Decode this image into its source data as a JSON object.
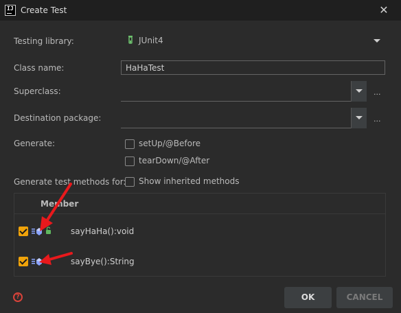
{
  "window": {
    "title": "Create Test",
    "app_icon_text": "IJ"
  },
  "form": {
    "testing_library_label": "Testing library:",
    "testing_library_value": "JUnit4",
    "class_name_label": "Class name:",
    "class_name_value": "HaHaTest",
    "superclass_label": "Superclass:",
    "superclass_value": "",
    "destination_label": "Destination package:",
    "destination_value": "",
    "ellipsis": "...",
    "generate_label": "Generate:",
    "setup_label": "setUp/@Before",
    "setup_checked": false,
    "teardown_label": "tearDown/@After",
    "teardown_checked": false,
    "methods_for_label": "Generate test methods for:",
    "inherited_label": "Show inherited methods",
    "inherited_checked": false
  },
  "table": {
    "header": "Member",
    "rows": [
      {
        "name": "sayHaHa():void",
        "checked": true,
        "icon": "public-method-icon"
      },
      {
        "name": "sayBye():String",
        "checked": true,
        "icon": "method-icon"
      }
    ]
  },
  "footer": {
    "help_icon": "?",
    "ok_label": "OK",
    "cancel_label": "CANCEL"
  },
  "colors": {
    "background": "#2b2b2b",
    "titlebar": "#1f1f1f",
    "checkbox_accent": "#f0a30a",
    "arrow": "#e8191c",
    "help": "#d9433a"
  }
}
